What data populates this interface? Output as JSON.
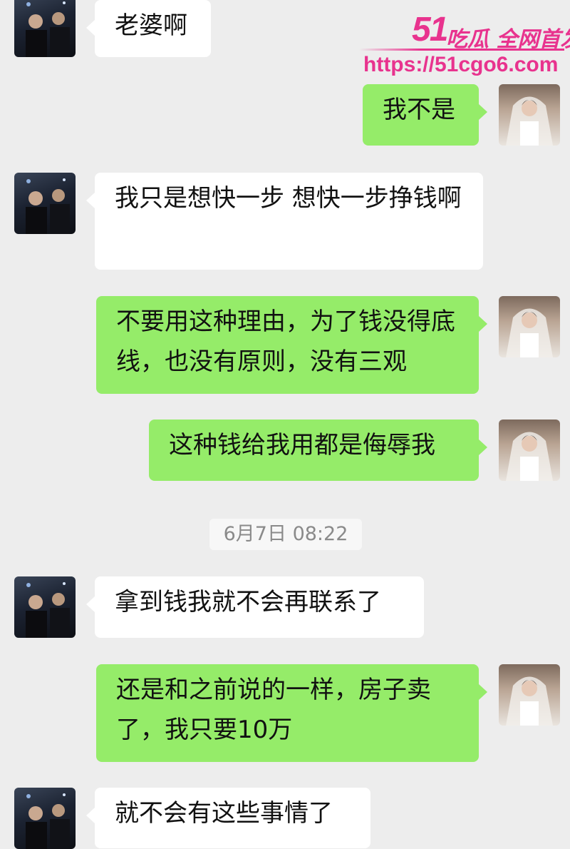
{
  "watermark": {
    "brand_number": "51",
    "brand_text": "吃瓜 全网首发",
    "url": "https://51cgo6.com",
    "color": "#e8338e"
  },
  "colors": {
    "chat_background": "#ededed",
    "incoming_bubble": "#ffffff",
    "outgoing_bubble": "#95ec69"
  },
  "messages": [
    {
      "side": "left",
      "text": "老婆啊"
    },
    {
      "side": "right",
      "text": "我不是"
    },
    {
      "side": "left",
      "text": "我只是想快一步 想快一步挣钱啊"
    },
    {
      "side": "right",
      "text": "不要用这种理由，为了钱没得底线，也没有原则，没有三观"
    },
    {
      "side": "right",
      "text": "这种钱给我用都是侮辱我"
    },
    {
      "side": "left",
      "text": "拿到钱我就不会再联系了"
    },
    {
      "side": "right",
      "text": "还是和之前说的一样，房子卖了，我只要10万"
    },
    {
      "side": "left",
      "text": "就不会有这些事情了"
    }
  ],
  "timestamp": "6月7日 08:22"
}
